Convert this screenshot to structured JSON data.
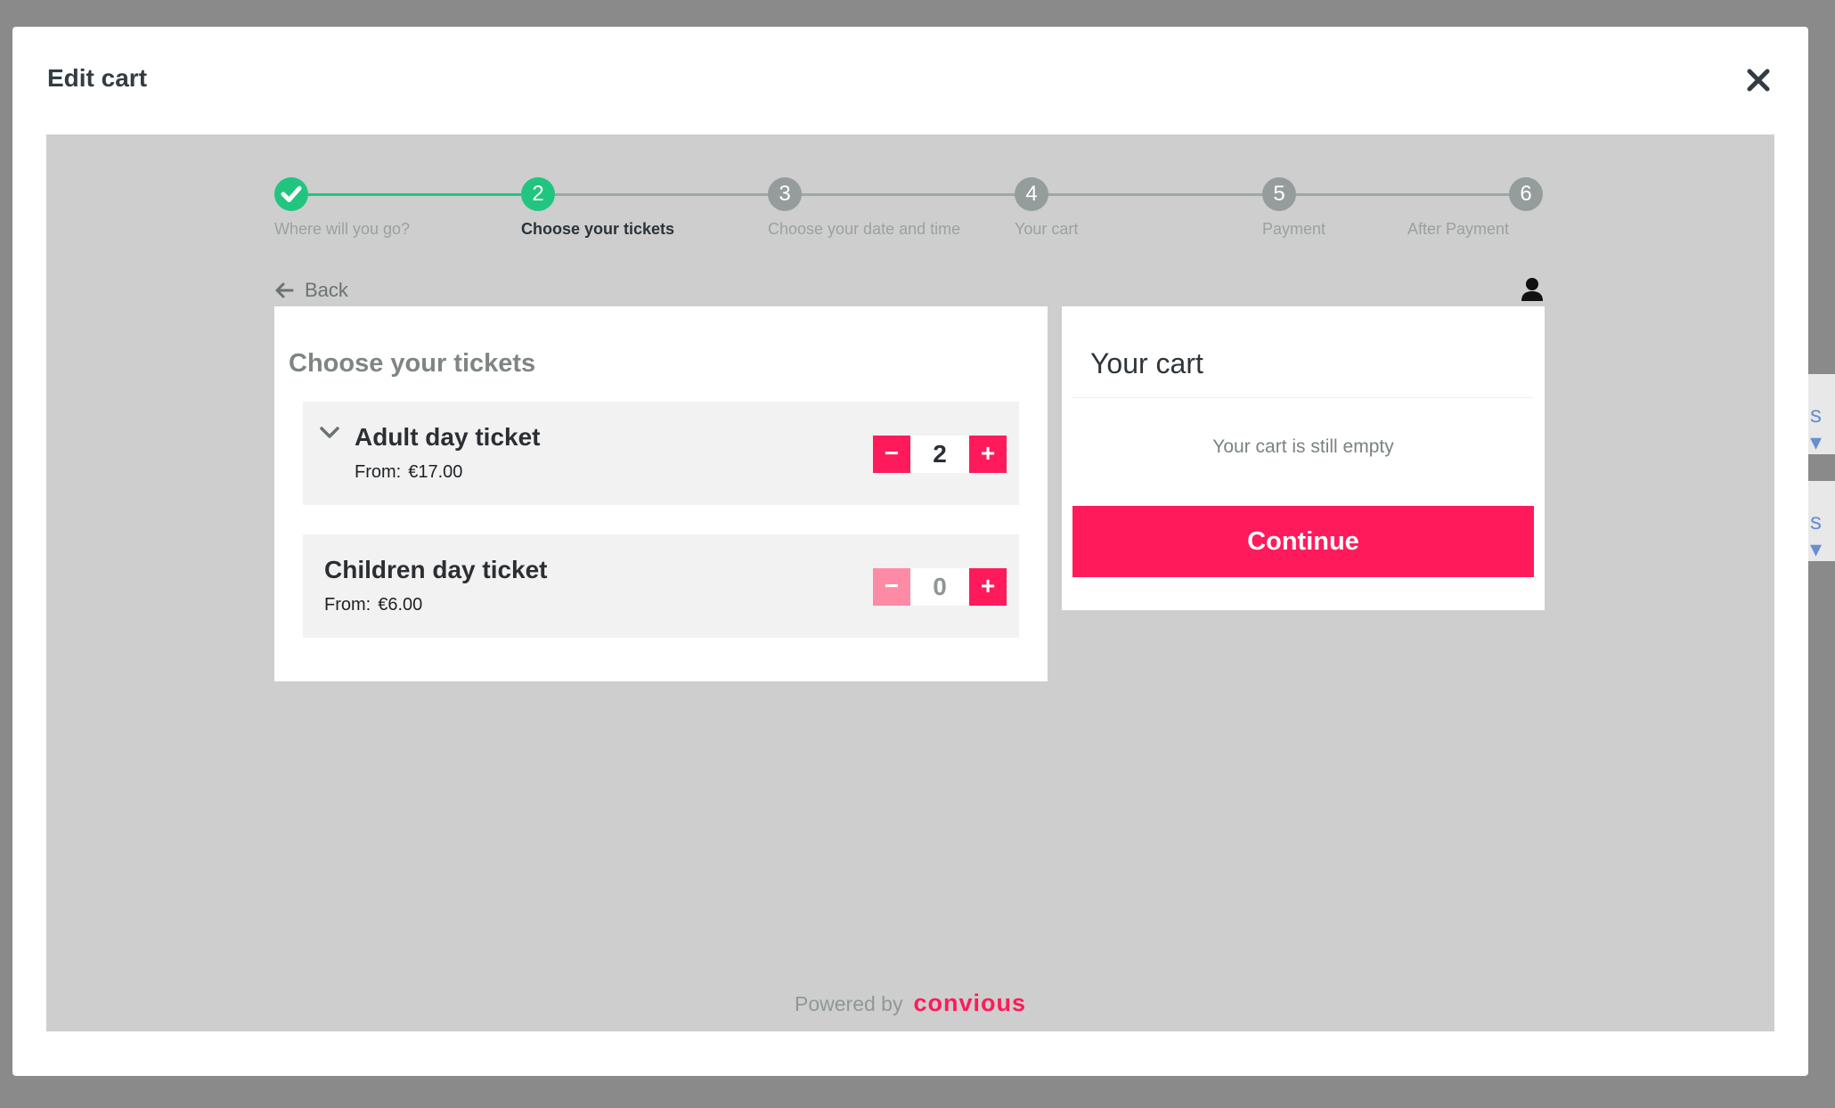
{
  "modal": {
    "title": "Edit cart"
  },
  "steps": [
    {
      "number": "1",
      "label": "Where will you go?",
      "state": "done"
    },
    {
      "number": "2",
      "label": "Choose your tickets",
      "state": "active"
    },
    {
      "number": "3",
      "label": "Choose your date and time",
      "state": "todo"
    },
    {
      "number": "4",
      "label": "Your cart",
      "state": "todo"
    },
    {
      "number": "5",
      "label": "Payment",
      "state": "todo"
    },
    {
      "number": "6",
      "label": "After Payment",
      "state": "todo"
    }
  ],
  "nav": {
    "back_label": "Back"
  },
  "tickets": {
    "title": "Choose your tickets",
    "items": [
      {
        "name": "Adult day ticket",
        "price_label": "From:",
        "price": "€17.00",
        "quantity": "2",
        "minus": "−",
        "plus": "+"
      },
      {
        "name": "Children day ticket",
        "price_label": "From:",
        "price": "€6.00",
        "quantity": "0",
        "minus": "−",
        "plus": "+"
      }
    ]
  },
  "cart": {
    "title": "Your cart",
    "empty_message": "Your cart is still empty",
    "continue_label": "Continue"
  },
  "footer": {
    "powered_by": "Powered by",
    "brand": "convious"
  },
  "colors": {
    "accent": "#ff1a5b",
    "success": "#22c580",
    "step_inactive": "#959d9c"
  }
}
